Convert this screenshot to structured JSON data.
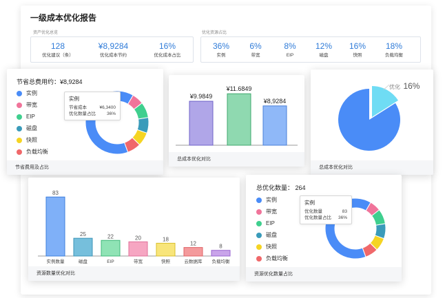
{
  "report": {
    "title": "一级成本优化报告",
    "asset_section_label": "资产优化总览",
    "resource_section_label": "优化资源占比"
  },
  "asset_kpis": [
    {
      "value": "128",
      "label": "优化建议（条）"
    },
    {
      "value": "¥8,9284",
      "label": "优化成本节约"
    },
    {
      "value": "16%",
      "label": "优化成本占比"
    }
  ],
  "resource_kpis": [
    {
      "value": "36%",
      "label": "实例"
    },
    {
      "value": "6%",
      "label": "带宽"
    },
    {
      "value": "8%",
      "label": "EIP"
    },
    {
      "value": "12%",
      "label": "磁盘"
    },
    {
      "value": "16%",
      "label": "快照"
    },
    {
      "value": "18%",
      "label": "负载均衡"
    }
  ],
  "savings_card": {
    "header": "节省总费用约：¥8,9284",
    "footer": "节省费用及占比",
    "tooltip": {
      "title": "实例",
      "rows": [
        {
          "label": "节省成本",
          "value": "¥6,3400"
        },
        {
          "label": "优化数量占比",
          "value": "36%"
        }
      ]
    }
  },
  "cost_compare_card": {
    "footer": "总成本优化对比"
  },
  "cost_ratio_card": {
    "footer": "总成本优化对比",
    "slice_label": "优化",
    "slice_value": "16%"
  },
  "resource_count_card": {
    "footer": "资源数量优化对比"
  },
  "resource_ratio_card": {
    "header": "总优化数量：  264",
    "footer": "资源优化数量占比",
    "tooltip": {
      "title": "实例",
      "rows": [
        {
          "label": "优化数量",
          "value": "83"
        },
        {
          "label": "优化数量占比",
          "value": "36%"
        }
      ]
    }
  },
  "legend": [
    {
      "label": "实例",
      "color": "#4a8cf7"
    },
    {
      "label": "带宽",
      "color": "#f0749a"
    },
    {
      "label": "EIP",
      "color": "#3fcf8e"
    },
    {
      "label": "磁盘",
      "color": "#3a9bba"
    },
    {
      "label": "快照",
      "color": "#f5d423"
    },
    {
      "label": "负载均衡",
      "color": "#f0686a"
    }
  ],
  "chart_data": [
    {
      "type": "pie",
      "id": "savings-donut",
      "categories": [
        "实例",
        "带宽",
        "EIP",
        "磁盘",
        "快照",
        "负载均衡"
      ],
      "values": [
        64,
        6,
        8,
        8,
        7,
        7
      ],
      "colors": [
        "#4a8cf7",
        "#f0749a",
        "#3fcf8e",
        "#3a9bba",
        "#f5d423",
        "#f0686a"
      ],
      "start_angle": 70
    },
    {
      "type": "bar",
      "id": "cost-bars",
      "values": [
        9.9849,
        11.6849,
        8.9284
      ],
      "value_labels": [
        "¥9.9849",
        "¥11.6849",
        "¥8,9284"
      ],
      "colors": [
        "#b0a6e8",
        "#8fd9b0",
        "#8fb8f8"
      ],
      "strokes": [
        "#6f63c8",
        "#3fa86e",
        "#4a7fd8"
      ],
      "ylim": [
        0,
        12.5
      ]
    },
    {
      "type": "pie",
      "id": "cost-ratio-pie",
      "categories": [
        "优化",
        "其他"
      ],
      "values": [
        16,
        84
      ],
      "colors": [
        "#6fdcf4",
        "#4a8cf7"
      ]
    },
    {
      "type": "bar",
      "id": "resource-bars",
      "categories": [
        "实例数量",
        "磁盘",
        "EIP",
        "带宽",
        "快照",
        "云数据库",
        "负载均衡"
      ],
      "values": [
        83,
        25,
        22,
        20,
        18,
        12,
        8
      ],
      "colors": [
        "#7fb0f8",
        "#76bfdc",
        "#8fe3b5",
        "#f6a6c2",
        "#f8e57a",
        "#f49a9c",
        "#c9a4ea"
      ],
      "strokes": [
        "#3e7fdc",
        "#3e95b8",
        "#3fb87a",
        "#e0709a",
        "#d8c02c",
        "#e06467",
        "#9a66d0"
      ],
      "ylim": [
        0,
        90
      ]
    },
    {
      "type": "pie",
      "id": "resource-donut",
      "categories": [
        "实例",
        "带宽",
        "EIP",
        "磁盘",
        "快照",
        "负载均衡"
      ],
      "values": [
        64,
        6,
        8,
        8,
        7,
        7
      ],
      "colors": [
        "#4a8cf7",
        "#f0749a",
        "#3fcf8e",
        "#3a9bba",
        "#f5d423",
        "#f0686a"
      ],
      "start_angle": 70
    }
  ]
}
